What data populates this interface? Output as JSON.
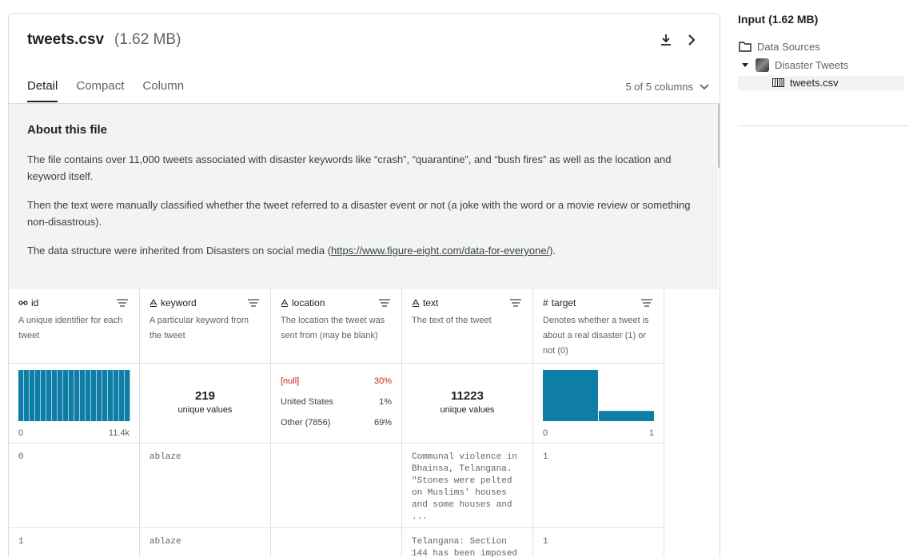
{
  "file": {
    "name": "tweets.csv",
    "size": "(1.62 MB)"
  },
  "tabs": [
    "Detail",
    "Compact",
    "Column"
  ],
  "column_selector": "5 of 5 columns",
  "about": {
    "heading": "About this file",
    "p1": "The file contains over 11,000 tweets associated with disaster keywords like “crash”, “quarantine”, and “bush fires” as well as the location and keyword itself.",
    "p2": "Then the text were manually classified whether the tweet referred to a disaster event or not (a joke with the word or a movie review or something non-disastrous).",
    "p3_prefix": "The data structure were inherited from Disasters on social media (",
    "p3_link": "https://www.figure-eight.com/data-for-everyone/",
    "p3_suffix": ")."
  },
  "columns": [
    {
      "type_icon": "key-icon",
      "name": "id",
      "description": "A unique identifier for each tweet"
    },
    {
      "type_icon": "string-icon",
      "name": "keyword",
      "description": "A particular keyword from the tweet"
    },
    {
      "type_icon": "string-icon",
      "name": "location",
      "description": "The location the tweet was sent from (may be blank)"
    },
    {
      "type_icon": "string-icon",
      "name": "text",
      "description": "The text of the tweet"
    },
    {
      "type_icon": "number-icon",
      "name": "target",
      "description": "Denotes whether a tweet is about a real disaster (1) or not (0)"
    }
  ],
  "stats": {
    "id": {
      "axis_min": "0",
      "axis_max": "11.4k",
      "histogram_bins": 20,
      "histogram_uniform": true
    },
    "keyword": {
      "count": "219",
      "label": "unique values"
    },
    "location": [
      {
        "label": "[null]",
        "pct": "30%"
      },
      {
        "label": "United States",
        "pct": "1%"
      },
      {
        "label": "Other (7856)",
        "pct": "69%"
      }
    ],
    "text": {
      "count": "11223",
      "label": "unique values"
    },
    "target": {
      "axis_min": "0",
      "axis_max": "1",
      "bar_levels": [
        1.0,
        0.2
      ]
    }
  },
  "rows": [
    {
      "id": "0",
      "keyword": "ablaze",
      "location": "",
      "text": "Communal violence in Bhainsa, Telangana. \"Stones were pelted on Muslims' houses and some houses and ...",
      "target": "1"
    },
    {
      "id": "1",
      "keyword": "ablaze",
      "location": "",
      "text": "Telangana: Section 144 has been imposed",
      "target": "1"
    }
  ],
  "sidebar": {
    "title": "Input (1.62 MB)",
    "data_sources": "Data Sources",
    "dataset": "Disaster Tweets",
    "file": "tweets.csv"
  },
  "colors": {
    "bar": "#0f7ea6",
    "null_text": "#c5221f"
  }
}
